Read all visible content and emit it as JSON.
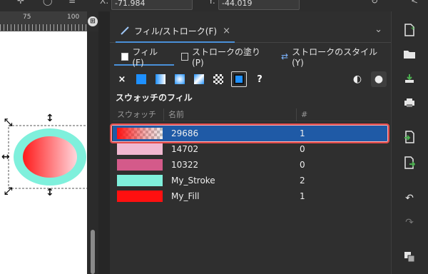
{
  "topbar": {
    "x_label": "X:",
    "x_value": "-71.984",
    "y_label": "Y:",
    "y_value": "-44.019"
  },
  "ruler": {
    "tick_label": "75",
    "tick_label_2": "100"
  },
  "dialog": {
    "tab_title": "フィル/ストローク(F)",
    "close_glyph": "×",
    "subtabs": [
      {
        "label": "フィル(F)"
      },
      {
        "label": "ストロークの塗り(P)"
      },
      {
        "label": "ストロークのスタイル(Y)"
      }
    ],
    "fill_types": {
      "none": "×",
      "unset": "?"
    },
    "section_title": "スウォッチのフィル",
    "columns": {
      "swatch": "スウォッチ",
      "name": "名前",
      "count": "#"
    },
    "rows": [
      {
        "name": "29686",
        "count": "1",
        "selected": true,
        "color": "gradient-red-transparent"
      },
      {
        "name": "14702",
        "count": "0",
        "selected": false,
        "color": "#f0b8d0"
      },
      {
        "name": "10322",
        "count": "0",
        "selected": false,
        "color": "#d45a8a"
      },
      {
        "name": "My_Stroke",
        "count": "2",
        "selected": false,
        "color": "#7ff0dc"
      },
      {
        "name": "My_Fill",
        "count": "1",
        "selected": false,
        "color": "#ff1010"
      }
    ]
  },
  "colors": {
    "accent": "#4a90d9",
    "selection": "#1f5aa6",
    "highlight_ring": "#e04a4a",
    "ellipse_stroke": "#7ff0dc",
    "ellipse_fill_start": "#ff1a1a"
  },
  "icons": {
    "right_toolbar": [
      "new-document-icon",
      "open-folder-icon",
      "save-icon",
      "print-icon",
      "import-icon",
      "export-icon",
      "undo-icon",
      "redo-icon",
      "duplicate-icon"
    ]
  }
}
